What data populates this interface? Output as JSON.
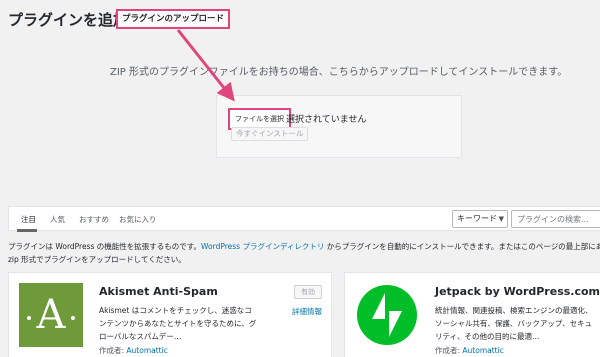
{
  "header": {
    "title": "プラグインを追加",
    "upload_button": "プラグインのアップロード"
  },
  "upload": {
    "help_text": "ZIP 形式のプラグインファイルをお持ちの場合、こちらからアップロードしてインストールできます。",
    "file_button": "ファイルを選択",
    "no_file_text": "選択されていません",
    "install_button": "今すぐインストール"
  },
  "filter": {
    "tabs": [
      {
        "label": "注目"
      },
      {
        "label": "人気"
      },
      {
        "label": "おすすめ"
      },
      {
        "label": "お気に入り"
      }
    ],
    "search_type": "キーワード",
    "search_placeholder": "プラグインの検索..."
  },
  "description": {
    "line1_pre": "プラグインは WordPress の機能性を拡張するものです。",
    "line1_link": "WordPress プラグインディレクトリ",
    "line1_post": " からプラグインを自動的にインストールできます。またはこのページの最上部にあるボタンを",
    "line2": "zip 形式でプラグインをアップロードしてください。"
  },
  "plugins": [
    {
      "name": "Akismet Anti-Spam",
      "icon": "akismet-logo",
      "icon_letter": "A",
      "icon_color": "#6e9a3a",
      "description_lines": [
        "Akismet はコメントをチェックし、迷惑なコ",
        "ンテンツからあなたとサイトを守るために、グ",
        "ローバルなスパムデー…"
      ],
      "author_label": "作成者:",
      "author": "Automattic",
      "status": "有効",
      "details": "詳細情報"
    },
    {
      "name": "Jetpack by WordPress.com",
      "icon": "jetpack-logo",
      "icon_color": "#00be28",
      "description_lines": [
        "統計情報、関連投稿、検索エンジンの最適化、",
        "ソーシャル共有、保護、バックアップ、セキュ",
        "リティ、その他の目的に最適…"
      ],
      "author_label": "作成者:",
      "author": "Automattic"
    }
  ],
  "colors": {
    "highlight": "#e0457b",
    "link": "#0073aa"
  }
}
